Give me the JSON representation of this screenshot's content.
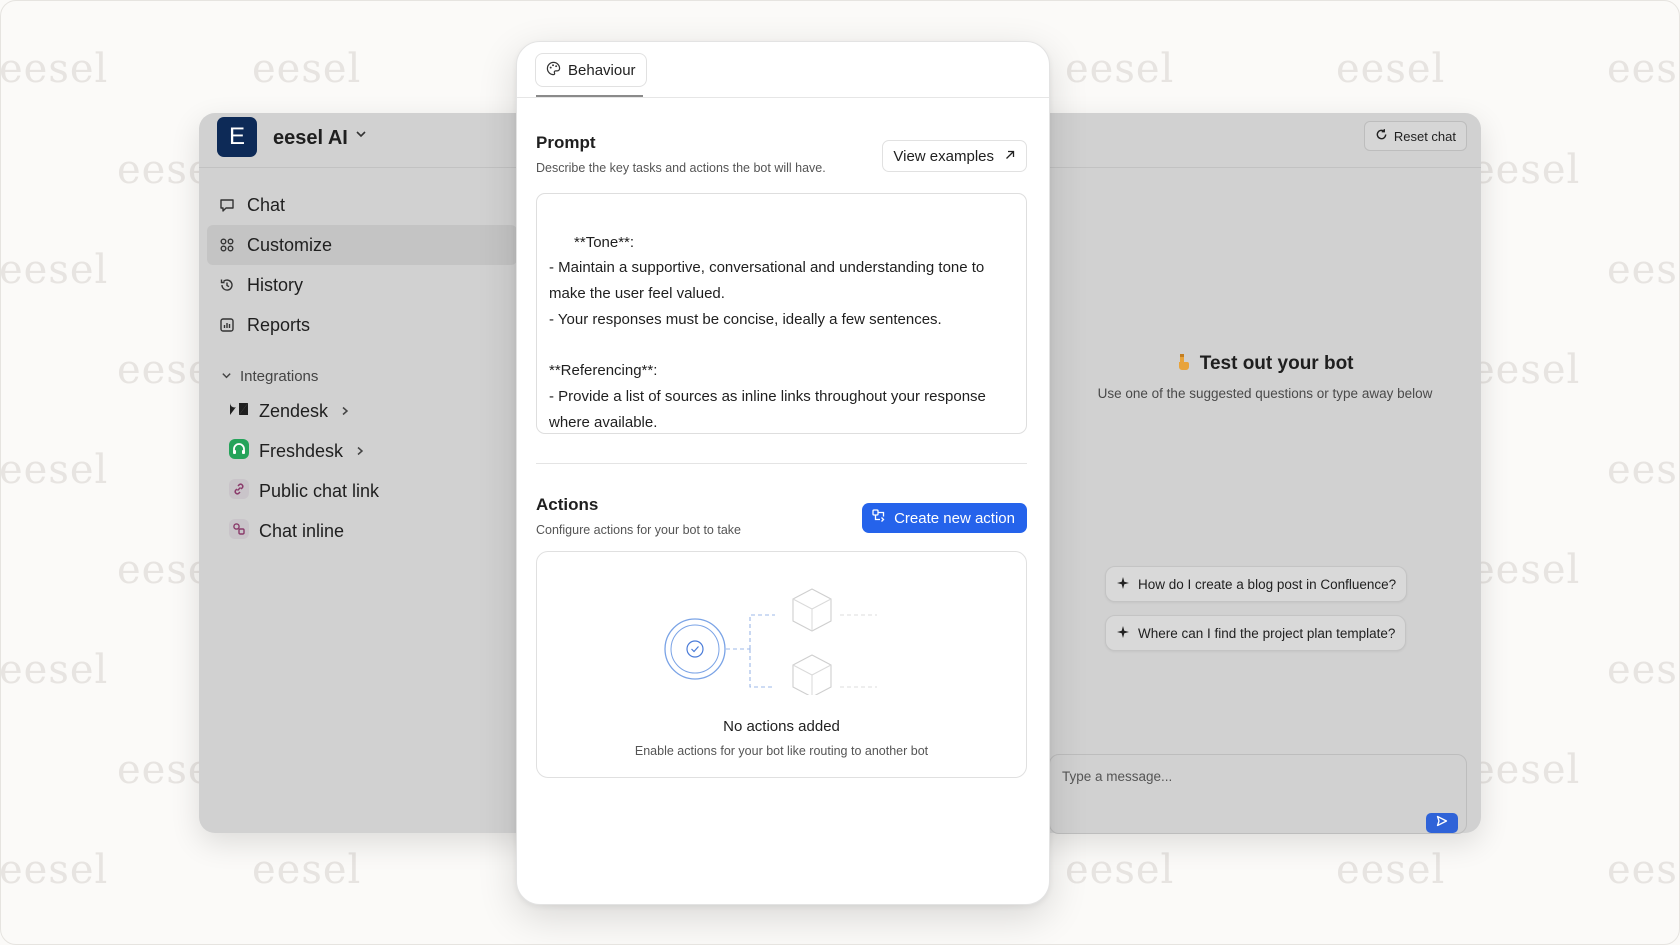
{
  "watermark": "eesel",
  "workspace": {
    "initial": "E",
    "name": "eesel AI"
  },
  "nav": [
    {
      "label": "Chat",
      "icon": "chat-bubble-icon"
    },
    {
      "label": "Customize",
      "icon": "customize-grid-icon",
      "active": true
    },
    {
      "label": "History",
      "icon": "history-icon"
    },
    {
      "label": "Reports",
      "icon": "reports-icon"
    }
  ],
  "integrations": {
    "heading": "Integrations",
    "items": [
      {
        "label": "Zendesk",
        "icon": "zendesk-logo-icon"
      },
      {
        "label": "Freshdesk",
        "icon": "freshdesk-logo-icon"
      },
      {
        "label": "Public chat link",
        "icon": "link-icon"
      },
      {
        "label": "Chat inline",
        "icon": "chat-inline-icon"
      }
    ]
  },
  "chat_panel": {
    "reset_label": "Reset chat",
    "test_title": "Test out your bot",
    "test_subtitle": "Use one of the suggested questions or type away below",
    "suggestions": [
      "How do I create a blog post in Confluence?",
      "Where can I find the project plan template?"
    ],
    "composer_placeholder": "Type a message..."
  },
  "panel": {
    "tab_label": "Behaviour",
    "prompt": {
      "title": "Prompt",
      "subtitle": "Describe the key tasks and actions the bot will have.",
      "view_examples": "View examples",
      "text": "**Tone**:\n- Maintain a supportive, conversational and understanding tone to make the user feel valued.\n- Your responses must be concise, ideally a few sentences.\n\n**Referencing**:\n- Provide a list of sources as inline links throughout your response where available."
    },
    "actions": {
      "title": "Actions",
      "subtitle": "Configure actions for your bot to take",
      "create_label": "Create new action",
      "empty_title": "No actions added",
      "empty_subtitle": "Enable actions for your bot like routing to another bot"
    }
  },
  "colors": {
    "accent": "#2563eb",
    "workspace_avatar": "#0d2a57",
    "freshdesk_green": "#25a35a"
  }
}
